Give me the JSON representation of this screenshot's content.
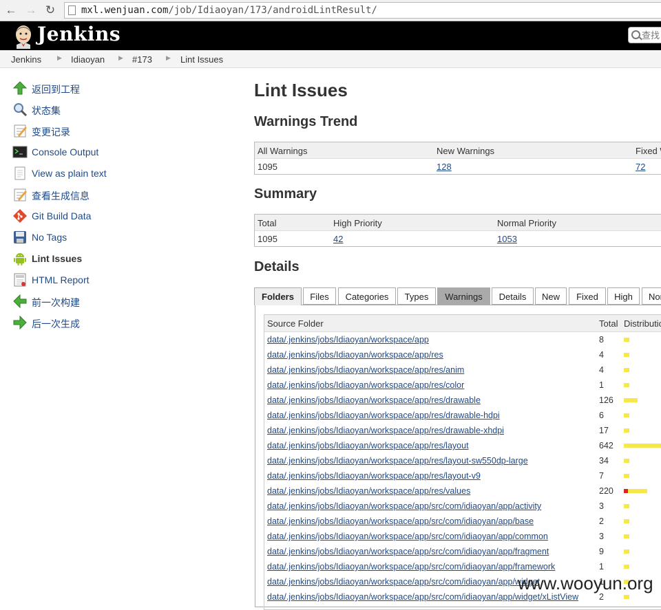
{
  "browser": {
    "url_host": "mxl.wenjuan.com",
    "url_path": "/job/Idiaoyan/173/androidLintResult/"
  },
  "header": {
    "app_name": "Jenkins",
    "search_placeholder": "查找"
  },
  "breadcrumb": [
    "Jenkins",
    "Idiaoyan",
    "#173",
    "Lint Issues"
  ],
  "sidebar": {
    "items": [
      {
        "label": "返回到工程",
        "icon": "up-arrow-icon"
      },
      {
        "label": "状态集",
        "icon": "magnifier-icon"
      },
      {
        "label": "变更记录",
        "icon": "notepad-icon"
      },
      {
        "label": "Console Output",
        "icon": "terminal-icon"
      },
      {
        "label": "View as plain text",
        "icon": "document-icon"
      },
      {
        "label": "查看生成信息",
        "icon": "notepad-icon"
      },
      {
        "label": "Git Build Data",
        "icon": "git-icon"
      },
      {
        "label": "No Tags",
        "icon": "floppy-disk-icon"
      },
      {
        "label": "Lint Issues",
        "icon": "android-icon"
      },
      {
        "label": "HTML Report",
        "icon": "report-icon"
      },
      {
        "label": "前一次构建",
        "icon": "left-arrow-icon"
      },
      {
        "label": "后一次生成",
        "icon": "right-arrow-icon"
      }
    ]
  },
  "main": {
    "title": "Lint Issues",
    "trend": {
      "heading": "Warnings Trend",
      "headers": [
        "All Warnings",
        "New Warnings",
        "Fixed W"
      ],
      "values": [
        "1095",
        "128",
        "72"
      ]
    },
    "summary": {
      "heading": "Summary",
      "headers": [
        "Total",
        "High Priority",
        "Normal Priority"
      ],
      "values": [
        "1095",
        "42",
        "1053"
      ]
    },
    "details": {
      "heading": "Details",
      "tabs": [
        "Folders",
        "Files",
        "Categories",
        "Types",
        "Warnings",
        "Details",
        "New",
        "Fixed",
        "High",
        "Nor"
      ],
      "columns": [
        "Source Folder",
        "Total",
        "Distributio"
      ],
      "rows": [
        {
          "folder": "data/.jenkins/jobs/Idiaoyan/workspace/app",
          "total": "8",
          "red": 0,
          "yellow": 8
        },
        {
          "folder": "data/.jenkins/jobs/Idiaoyan/workspace/app/res",
          "total": "4",
          "red": 0,
          "yellow": 4
        },
        {
          "folder": "data/.jenkins/jobs/Idiaoyan/workspace/app/res/anim",
          "total": "4",
          "red": 0,
          "yellow": 4
        },
        {
          "folder": "data/.jenkins/jobs/Idiaoyan/workspace/app/res/color",
          "total": "1",
          "red": 0,
          "yellow": 1
        },
        {
          "folder": "data/.jenkins/jobs/Idiaoyan/workspace/app/res/drawable",
          "total": "126",
          "red": 0,
          "yellow": 126
        },
        {
          "folder": "data/.jenkins/jobs/Idiaoyan/workspace/app/res/drawable-hdpi",
          "total": "6",
          "red": 0,
          "yellow": 6
        },
        {
          "folder": "data/.jenkins/jobs/Idiaoyan/workspace/app/res/drawable-xhdpi",
          "total": "17",
          "red": 0,
          "yellow": 17
        },
        {
          "folder": "data/.jenkins/jobs/Idiaoyan/workspace/app/res/layout",
          "total": "642",
          "red": 0,
          "yellow": 642
        },
        {
          "folder": "data/.jenkins/jobs/Idiaoyan/workspace/app/res/layout-sw550dp-large",
          "total": "34",
          "red": 0,
          "yellow": 34
        },
        {
          "folder": "data/.jenkins/jobs/Idiaoyan/workspace/app/res/layout-v9",
          "total": "7",
          "red": 0,
          "yellow": 7
        },
        {
          "folder": "data/.jenkins/jobs/Idiaoyan/workspace/app/res/values",
          "total": "220",
          "red": 42,
          "yellow": 178
        },
        {
          "folder": "data/.jenkins/jobs/Idiaoyan/workspace/app/src/com/idiaoyan/app/activity",
          "total": "3",
          "red": 0,
          "yellow": 3
        },
        {
          "folder": "data/.jenkins/jobs/Idiaoyan/workspace/app/src/com/idiaoyan/app/base",
          "total": "2",
          "red": 0,
          "yellow": 2
        },
        {
          "folder": "data/.jenkins/jobs/Idiaoyan/workspace/app/src/com/idiaoyan/app/common",
          "total": "3",
          "red": 0,
          "yellow": 3
        },
        {
          "folder": "data/.jenkins/jobs/Idiaoyan/workspace/app/src/com/idiaoyan/app/fragment",
          "total": "9",
          "red": 0,
          "yellow": 9
        },
        {
          "folder": "data/.jenkins/jobs/Idiaoyan/workspace/app/src/com/idiaoyan/app/framework",
          "total": "1",
          "red": 0,
          "yellow": 1
        },
        {
          "folder": "data/.jenkins/jobs/Idiaoyan/workspace/app/src/com/idiaoyan/app/widget",
          "total": "1",
          "red": 0,
          "yellow": 1
        },
        {
          "folder": "data/.jenkins/jobs/Idiaoyan/workspace/app/src/com/idiaoyan/app/widget/xListView",
          "total": "2",
          "red": 0,
          "yellow": 2
        }
      ]
    }
  },
  "colors": {
    "link": "#204a87",
    "high": "#d9261c",
    "normal": "#f7e84a"
  },
  "watermark": "www.wooyun.org"
}
